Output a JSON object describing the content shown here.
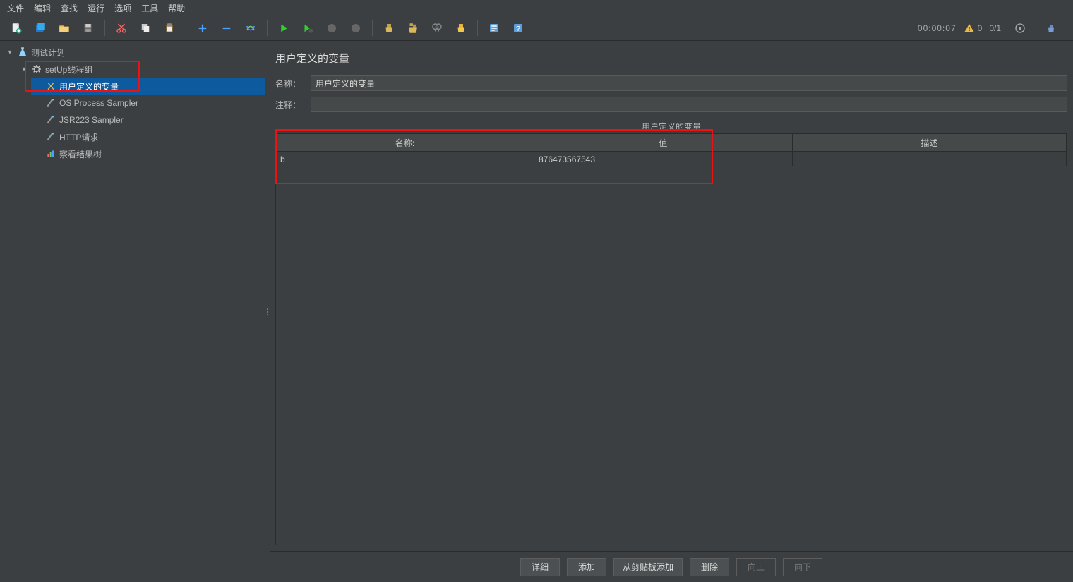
{
  "menu": {
    "items": [
      "文件",
      "编辑",
      "查找",
      "运行",
      "选项",
      "工具",
      "帮助"
    ]
  },
  "status": {
    "timer": "00:00:07",
    "warn_count": "0",
    "threads": "0/1"
  },
  "tree": {
    "root": {
      "label": "测试计划"
    },
    "thread_group": {
      "label": "setUp线程组"
    },
    "children": [
      {
        "label": "用户定义的变量",
        "icon": "variables-icon",
        "selected": true
      },
      {
        "label": "OS Process Sampler",
        "icon": "sampler-icon"
      },
      {
        "label": "JSR223 Sampler",
        "icon": "sampler-icon"
      },
      {
        "label": "HTTP请求",
        "icon": "sampler-icon"
      },
      {
        "label": "察看结果树",
        "icon": "results-icon"
      }
    ]
  },
  "panel": {
    "title": "用户定义的变量",
    "name_label": "名称：",
    "name_value": "用户定义的变量",
    "comment_label": "注释：",
    "comment_value": "",
    "section_label": "用户定义的变量",
    "columns": {
      "name": "名称:",
      "value": "值",
      "desc": "描述"
    },
    "rows": [
      {
        "name": "b",
        "value": "876473567543",
        "desc": ""
      }
    ],
    "buttons": {
      "detail": "详细",
      "add": "添加",
      "clipboard": "从剪贴板添加",
      "delete": "删除",
      "up": "向上",
      "down": "向下"
    }
  }
}
